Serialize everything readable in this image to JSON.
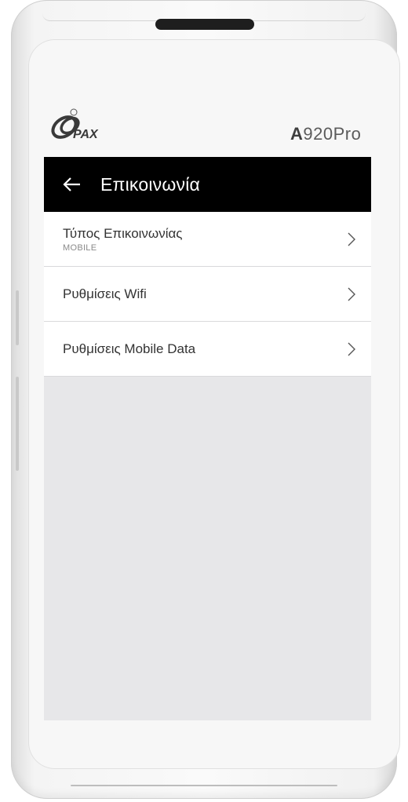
{
  "device": {
    "brand": "PAX",
    "model_prefix": "A",
    "model_suffix": "920Pro"
  },
  "app_bar": {
    "back_icon": "arrow-left-icon",
    "title": "Επικοινωνία"
  },
  "menu": {
    "items": [
      {
        "label": "Τύπος Επικοινωνίας",
        "sublabel": "MOBILE",
        "icon": "chevron-right-icon"
      },
      {
        "label": "Ρυθμίσεις Wifi",
        "icon": "chevron-right-icon"
      },
      {
        "label": "Ρυθμίσεις Mobile Data",
        "icon": "chevron-right-icon"
      }
    ]
  },
  "colors": {
    "app_bar_bg": "#000000",
    "screen_bg": "#e7e7e9",
    "item_bg": "#ffffff"
  }
}
